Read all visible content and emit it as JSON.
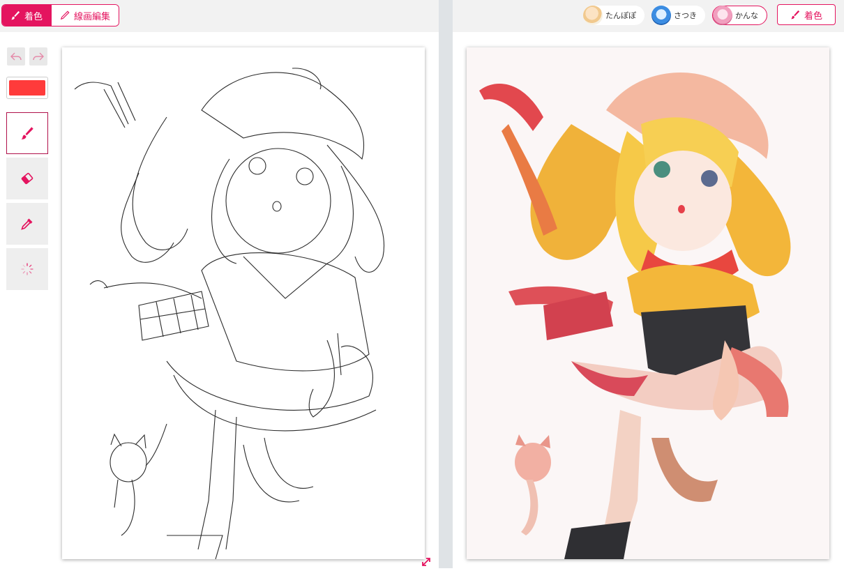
{
  "left": {
    "mode_tabs": [
      {
        "label": "着色",
        "icon": "brush-icon",
        "active": true
      },
      {
        "label": "線画編集",
        "icon": "pen-icon",
        "active": false
      }
    ],
    "tools": {
      "undo_icon": "undo-icon",
      "redo_icon": "redo-icon",
      "color": "#ff3b3b",
      "items": [
        {
          "name": "brush",
          "icon": "brush-icon",
          "active": true
        },
        {
          "name": "eraser",
          "icon": "eraser-icon",
          "active": false
        },
        {
          "name": "eyedropper",
          "icon": "eyedropper-icon",
          "active": false
        },
        {
          "name": "loading",
          "icon": "spinner-icon",
          "active": false
        }
      ]
    }
  },
  "right": {
    "styles": [
      {
        "label": "たんぽぽ",
        "selected": false
      },
      {
        "label": "さつき",
        "selected": false
      },
      {
        "label": "かんな",
        "selected": true
      }
    ],
    "colorize_label": "着色"
  },
  "colors": {
    "accent": "#e4145f",
    "divider": "#dfe3e6",
    "topbar": "#f2f2f2"
  }
}
